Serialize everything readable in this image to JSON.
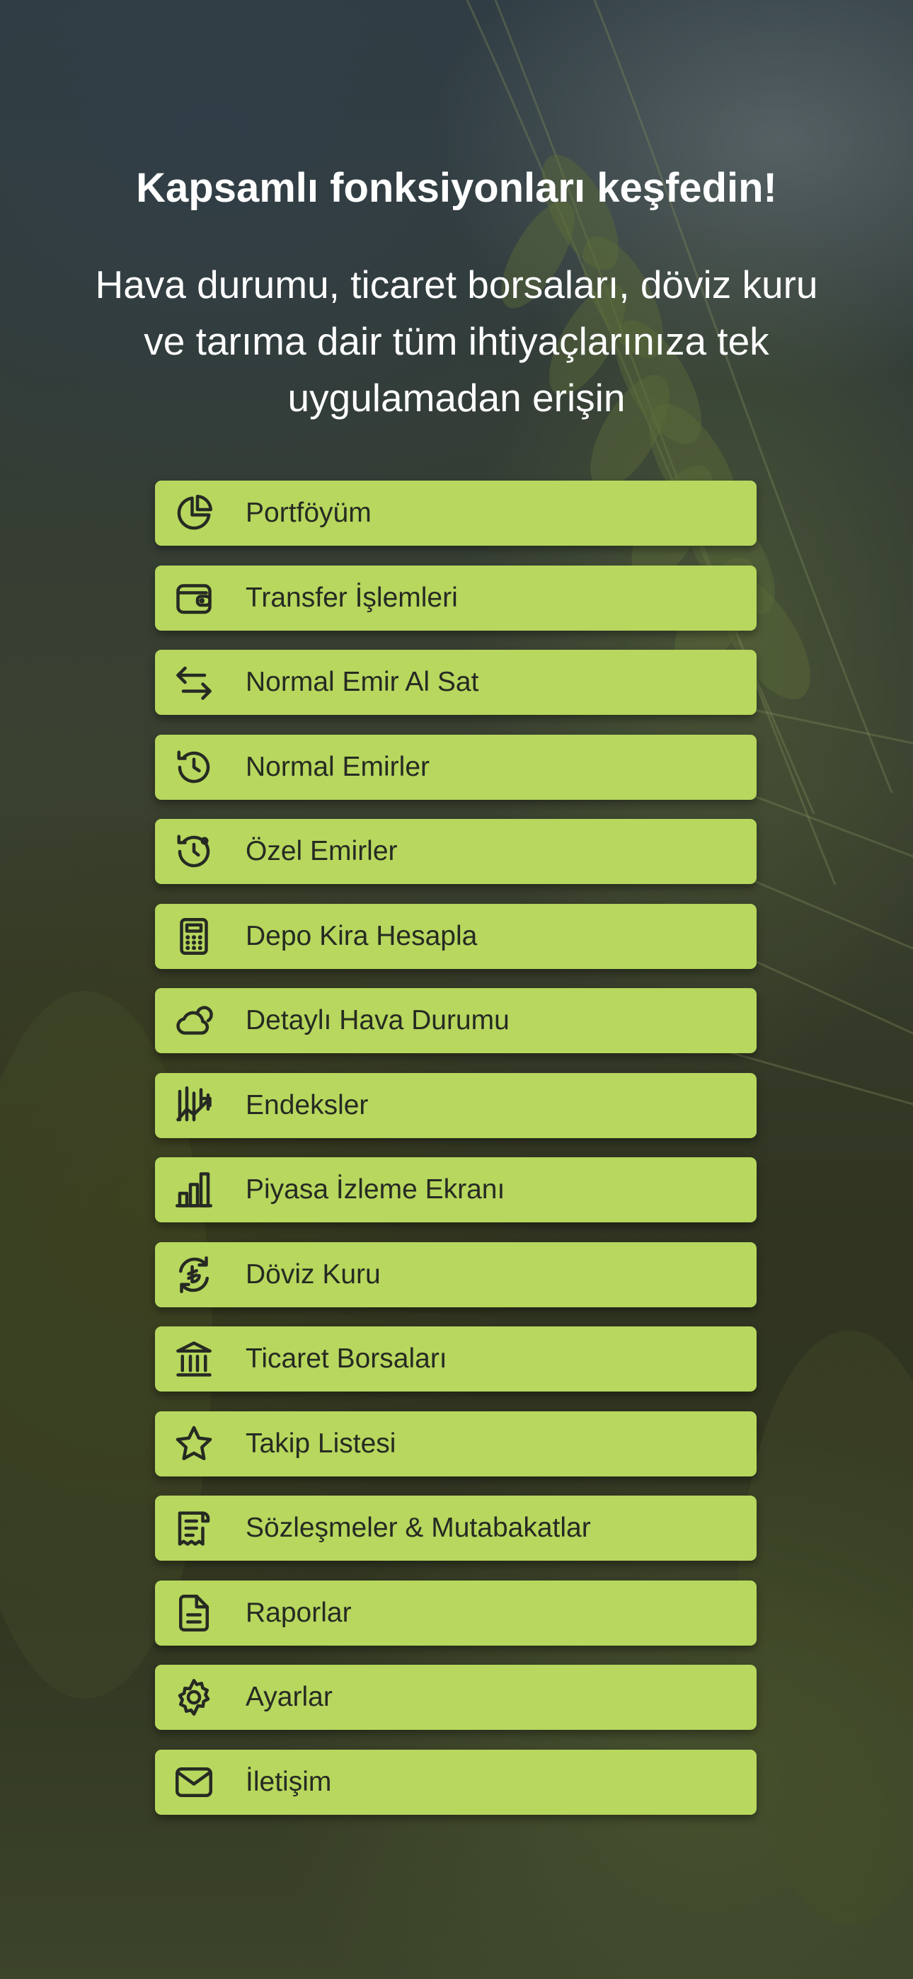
{
  "hero": {
    "title": "Kapsamlı fonksiyonları keşfedin!",
    "description": "Hava durumu, ticaret borsaları, döviz kuru ve tarıma dair tüm ihtiyaçlarınıza tek uygulamadan erişin"
  },
  "menu": {
    "button_color": "#b7d75e",
    "items": [
      {
        "label": "Portföyüm",
        "icon": "pie-chart-icon"
      },
      {
        "label": "Transfer İşlemleri",
        "icon": "wallet-icon"
      },
      {
        "label": "Normal Emir Al Sat",
        "icon": "arrows-left-right-icon"
      },
      {
        "label": "Normal Emirler",
        "icon": "history-icon"
      },
      {
        "label": "Özel Emirler",
        "icon": "history-alert-icon"
      },
      {
        "label": "Depo Kira Hesapla",
        "icon": "calculator-icon"
      },
      {
        "label": "Detaylı Hava Durumu",
        "icon": "weather-icon"
      },
      {
        "label": "Endeksler",
        "icon": "candlestick-chart-icon"
      },
      {
        "label": "Piyasa İzleme Ekranı",
        "icon": "bar-chart-icon"
      },
      {
        "label": "Döviz Kuru",
        "icon": "currency-exchange-icon"
      },
      {
        "label": "Ticaret Borsaları",
        "icon": "bank-icon"
      },
      {
        "label": "Takip Listesi",
        "icon": "star-icon"
      },
      {
        "label": "Sözleşmeler & Mutabakatlar",
        "icon": "receipt-icon"
      },
      {
        "label": "Raporlar",
        "icon": "document-icon"
      },
      {
        "label": "Ayarlar",
        "icon": "gear-icon"
      },
      {
        "label": "İletişim",
        "icon": "mail-icon"
      }
    ]
  }
}
